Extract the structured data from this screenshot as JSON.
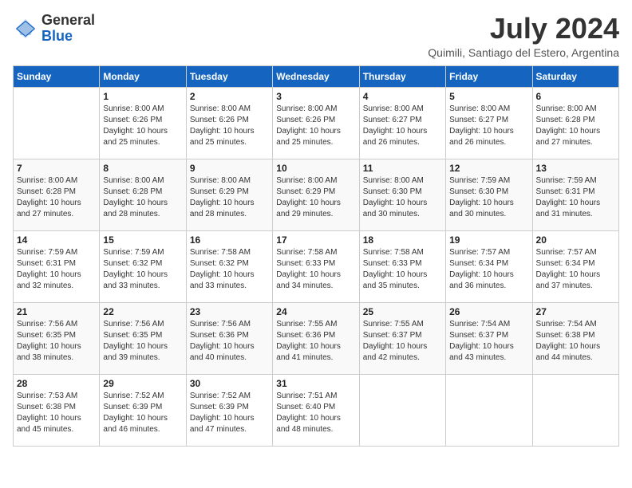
{
  "header": {
    "logo_general": "General",
    "logo_blue": "Blue",
    "month_year": "July 2024",
    "location": "Quimili, Santiago del Estero, Argentina"
  },
  "calendar": {
    "days_of_week": [
      "Sunday",
      "Monday",
      "Tuesday",
      "Wednesday",
      "Thursday",
      "Friday",
      "Saturday"
    ],
    "weeks": [
      [
        {
          "day": "",
          "info": ""
        },
        {
          "day": "1",
          "info": "Sunrise: 8:00 AM\nSunset: 6:26 PM\nDaylight: 10 hours\nand 25 minutes."
        },
        {
          "day": "2",
          "info": "Sunrise: 8:00 AM\nSunset: 6:26 PM\nDaylight: 10 hours\nand 25 minutes."
        },
        {
          "day": "3",
          "info": "Sunrise: 8:00 AM\nSunset: 6:26 PM\nDaylight: 10 hours\nand 25 minutes."
        },
        {
          "day": "4",
          "info": "Sunrise: 8:00 AM\nSunset: 6:27 PM\nDaylight: 10 hours\nand 26 minutes."
        },
        {
          "day": "5",
          "info": "Sunrise: 8:00 AM\nSunset: 6:27 PM\nDaylight: 10 hours\nand 26 minutes."
        },
        {
          "day": "6",
          "info": "Sunrise: 8:00 AM\nSunset: 6:28 PM\nDaylight: 10 hours\nand 27 minutes."
        }
      ],
      [
        {
          "day": "7",
          "info": "Sunrise: 8:00 AM\nSunset: 6:28 PM\nDaylight: 10 hours\nand 27 minutes."
        },
        {
          "day": "8",
          "info": "Sunrise: 8:00 AM\nSunset: 6:28 PM\nDaylight: 10 hours\nand 28 minutes."
        },
        {
          "day": "9",
          "info": "Sunrise: 8:00 AM\nSunset: 6:29 PM\nDaylight: 10 hours\nand 28 minutes."
        },
        {
          "day": "10",
          "info": "Sunrise: 8:00 AM\nSunset: 6:29 PM\nDaylight: 10 hours\nand 29 minutes."
        },
        {
          "day": "11",
          "info": "Sunrise: 8:00 AM\nSunset: 6:30 PM\nDaylight: 10 hours\nand 30 minutes."
        },
        {
          "day": "12",
          "info": "Sunrise: 7:59 AM\nSunset: 6:30 PM\nDaylight: 10 hours\nand 30 minutes."
        },
        {
          "day": "13",
          "info": "Sunrise: 7:59 AM\nSunset: 6:31 PM\nDaylight: 10 hours\nand 31 minutes."
        }
      ],
      [
        {
          "day": "14",
          "info": "Sunrise: 7:59 AM\nSunset: 6:31 PM\nDaylight: 10 hours\nand 32 minutes."
        },
        {
          "day": "15",
          "info": "Sunrise: 7:59 AM\nSunset: 6:32 PM\nDaylight: 10 hours\nand 33 minutes."
        },
        {
          "day": "16",
          "info": "Sunrise: 7:58 AM\nSunset: 6:32 PM\nDaylight: 10 hours\nand 33 minutes."
        },
        {
          "day": "17",
          "info": "Sunrise: 7:58 AM\nSunset: 6:33 PM\nDaylight: 10 hours\nand 34 minutes."
        },
        {
          "day": "18",
          "info": "Sunrise: 7:58 AM\nSunset: 6:33 PM\nDaylight: 10 hours\nand 35 minutes."
        },
        {
          "day": "19",
          "info": "Sunrise: 7:57 AM\nSunset: 6:34 PM\nDaylight: 10 hours\nand 36 minutes."
        },
        {
          "day": "20",
          "info": "Sunrise: 7:57 AM\nSunset: 6:34 PM\nDaylight: 10 hours\nand 37 minutes."
        }
      ],
      [
        {
          "day": "21",
          "info": "Sunrise: 7:56 AM\nSunset: 6:35 PM\nDaylight: 10 hours\nand 38 minutes."
        },
        {
          "day": "22",
          "info": "Sunrise: 7:56 AM\nSunset: 6:35 PM\nDaylight: 10 hours\nand 39 minutes."
        },
        {
          "day": "23",
          "info": "Sunrise: 7:56 AM\nSunset: 6:36 PM\nDaylight: 10 hours\nand 40 minutes."
        },
        {
          "day": "24",
          "info": "Sunrise: 7:55 AM\nSunset: 6:36 PM\nDaylight: 10 hours\nand 41 minutes."
        },
        {
          "day": "25",
          "info": "Sunrise: 7:55 AM\nSunset: 6:37 PM\nDaylight: 10 hours\nand 42 minutes."
        },
        {
          "day": "26",
          "info": "Sunrise: 7:54 AM\nSunset: 6:37 PM\nDaylight: 10 hours\nand 43 minutes."
        },
        {
          "day": "27",
          "info": "Sunrise: 7:54 AM\nSunset: 6:38 PM\nDaylight: 10 hours\nand 44 minutes."
        }
      ],
      [
        {
          "day": "28",
          "info": "Sunrise: 7:53 AM\nSunset: 6:38 PM\nDaylight: 10 hours\nand 45 minutes."
        },
        {
          "day": "29",
          "info": "Sunrise: 7:52 AM\nSunset: 6:39 PM\nDaylight: 10 hours\nand 46 minutes."
        },
        {
          "day": "30",
          "info": "Sunrise: 7:52 AM\nSunset: 6:39 PM\nDaylight: 10 hours\nand 47 minutes."
        },
        {
          "day": "31",
          "info": "Sunrise: 7:51 AM\nSunset: 6:40 PM\nDaylight: 10 hours\nand 48 minutes."
        },
        {
          "day": "",
          "info": ""
        },
        {
          "day": "",
          "info": ""
        },
        {
          "day": "",
          "info": ""
        }
      ]
    ]
  }
}
